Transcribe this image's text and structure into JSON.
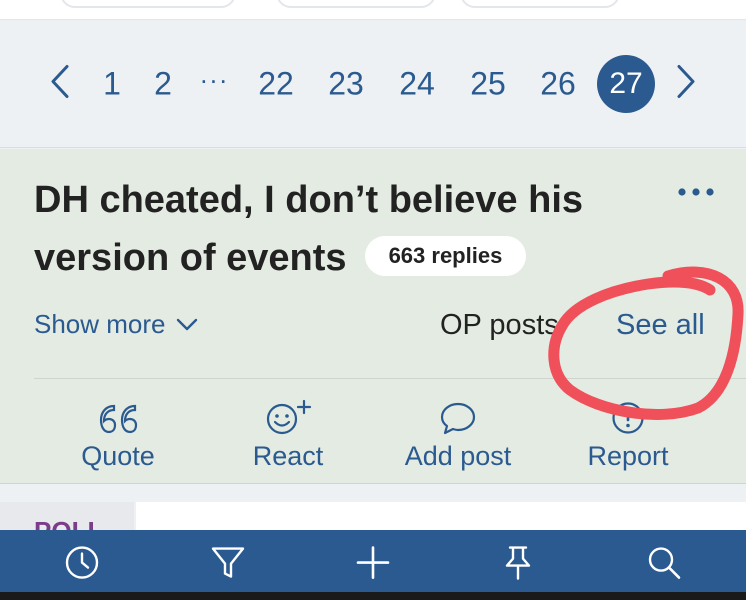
{
  "pagination": {
    "prev_icon": "chevron-left-icon",
    "pages": [
      "1",
      "2",
      "22",
      "23",
      "24",
      "25",
      "26"
    ],
    "ellipsis": "···",
    "current": "27",
    "next_icon": "chevron-right-icon"
  },
  "thread": {
    "title": "DH cheated, I don’t believe his version of events",
    "replies": "663 replies",
    "menu_icon": "more-dots-icon",
    "show_more": "Show more",
    "op_posts": "OP posts",
    "see_all": "See all",
    "actions": [
      {
        "label": "Quote",
        "icon": "quote-icon"
      },
      {
        "label": "React",
        "icon": "smiley-plus-icon"
      },
      {
        "label": "Add post",
        "icon": "speech-bubble-icon"
      },
      {
        "label": "Report",
        "icon": "alert-circle-icon"
      }
    ]
  },
  "poll": {
    "label": "POLL"
  },
  "bottom_nav": {
    "items": [
      "clock-icon",
      "filter-icon",
      "plus-icon",
      "pin-icon",
      "search-icon"
    ]
  },
  "colors": {
    "accent": "#2a5a8f",
    "thread_bg": "#e3ebe2",
    "annotation": "#f0505a"
  }
}
